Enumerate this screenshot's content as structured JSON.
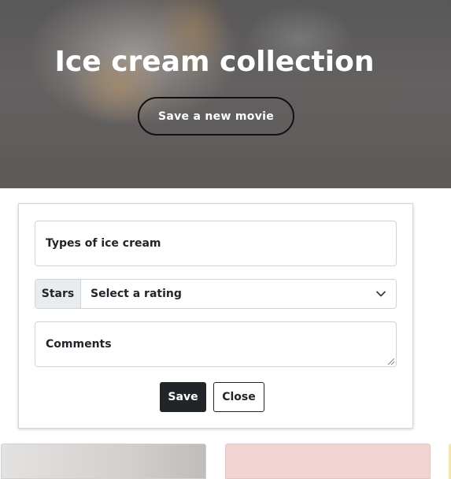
{
  "hero": {
    "title": "Ice cream collection",
    "button_label": "Save a new movie"
  },
  "form": {
    "types_label": "Types of ice cream",
    "rating_prefix": "Stars",
    "rating_selected": "Select a rating",
    "comments_label": "Comments",
    "save_label": "Save",
    "close_label": "Close"
  },
  "colors": {
    "dark": "#212529",
    "border": "#ced4da",
    "prefix_bg": "#e9ecef"
  },
  "icons": {
    "select_arrow": "chevron-down-icon",
    "textarea_grip": "resize-grip-icon"
  }
}
